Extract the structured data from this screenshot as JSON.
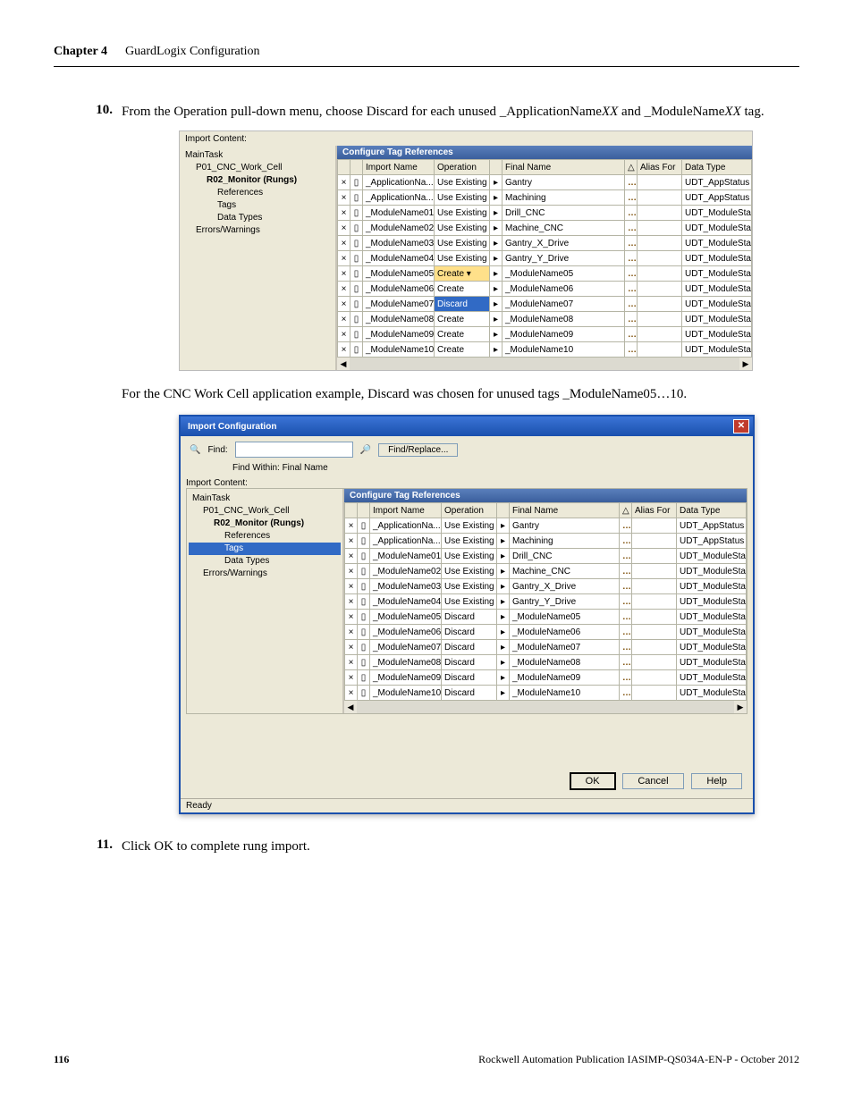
{
  "header": {
    "chapter_label": "Chapter 4",
    "chapter_title": "GuardLogix Configuration"
  },
  "steps": {
    "s10": {
      "num": "10.",
      "text": "From the Operation pull-down menu, choose Discard for each unused _ApplicationNameXX and _ModuleNameXX tag."
    },
    "s11": {
      "num": "11.",
      "text": "Click OK to complete rung import."
    }
  },
  "mid_text": "For the CNC Work Cell application example, Discard was chosen for unused tags _ModuleName05…10.",
  "screenshot1": {
    "import_content_label": "Import Content:",
    "tree": {
      "main": "MainTask",
      "p01": "P01_CNC_Work_Cell",
      "r02": "R02_Monitor (Rungs)",
      "refs": "References",
      "tags": "Tags",
      "datatypes": "Data Types",
      "errors": "Errors/Warnings"
    },
    "grid_title": "Configure Tag References",
    "columns": {
      "import": "Import Name",
      "operation": "Operation",
      "final": "Final Name",
      "alias": "Alias For",
      "datatype": "Data Type"
    },
    "rows": [
      {
        "import": "_ApplicationNa...",
        "op": "Use Existing",
        "final": "Gantry",
        "dt": "UDT_AppStatus"
      },
      {
        "import": "_ApplicationNa...",
        "op": "Use Existing",
        "final": "Machining",
        "dt": "UDT_AppStatus"
      },
      {
        "import": "_ModuleName01",
        "op": "Use Existing",
        "final": "Drill_CNC",
        "dt": "UDT_ModuleSta"
      },
      {
        "import": "_ModuleName02",
        "op": "Use Existing",
        "final": "Machine_CNC",
        "dt": "UDT_ModuleSta"
      },
      {
        "import": "_ModuleName03",
        "op": "Use Existing",
        "final": "Gantry_X_Drive",
        "dt": "UDT_ModuleSta"
      },
      {
        "import": "_ModuleName04",
        "op": "Use Existing",
        "final": "Gantry_Y_Drive",
        "dt": "UDT_ModuleSta"
      },
      {
        "import": "_ModuleName05",
        "op": "Create",
        "final": "_ModuleName05",
        "dt": "UDT_ModuleSta",
        "dropdown": true
      },
      {
        "import": "_ModuleName06",
        "op": "Create",
        "final": "_ModuleName06",
        "dt": "UDT_ModuleSta"
      },
      {
        "import": "_ModuleName07",
        "op": "Discard",
        "final": "_ModuleName07",
        "dt": "UDT_ModuleSta",
        "opsel": true
      },
      {
        "import": "_ModuleName08",
        "op": "Create",
        "final": "_ModuleName08",
        "dt": "UDT_ModuleSta"
      },
      {
        "import": "_ModuleName09",
        "op": "Create",
        "final": "_ModuleName09",
        "dt": "UDT_ModuleSta"
      },
      {
        "import": "_ModuleName10",
        "op": "Create",
        "final": "_ModuleName10",
        "dt": "UDT_ModuleSta"
      }
    ]
  },
  "screenshot2": {
    "title": "Import Configuration",
    "find_label": "Find:",
    "find_replace_btn": "Find/Replace...",
    "find_within": "Find Within: Final Name",
    "import_content_label": "Import Content:",
    "tree": {
      "main": "MainTask",
      "p01": "P01_CNC_Work_Cell",
      "r02": "R02_Monitor (Rungs)",
      "refs": "References",
      "tags": "Tags",
      "datatypes": "Data Types",
      "errors": "Errors/Warnings"
    },
    "grid_title": "Configure Tag References",
    "columns": {
      "import": "Import Name",
      "operation": "Operation",
      "final": "Final Name",
      "alias": "Alias For",
      "datatype": "Data Type"
    },
    "rows": [
      {
        "import": "_ApplicationNa...",
        "op": "Use Existing",
        "final": "Gantry",
        "dt": "UDT_AppStatus"
      },
      {
        "import": "_ApplicationNa...",
        "op": "Use Existing",
        "final": "Machining",
        "dt": "UDT_AppStatus"
      },
      {
        "import": "_ModuleName01",
        "op": "Use Existing",
        "final": "Drill_CNC",
        "dt": "UDT_ModuleSta"
      },
      {
        "import": "_ModuleName02",
        "op": "Use Existing",
        "final": "Machine_CNC",
        "dt": "UDT_ModuleSta"
      },
      {
        "import": "_ModuleName03",
        "op": "Use Existing",
        "final": "Gantry_X_Drive",
        "dt": "UDT_ModuleSta"
      },
      {
        "import": "_ModuleName04",
        "op": "Use Existing",
        "final": "Gantry_Y_Drive",
        "dt": "UDT_ModuleSta"
      },
      {
        "import": "_ModuleName05",
        "op": "Discard",
        "final": "_ModuleName05",
        "dt": "UDT_ModuleSta"
      },
      {
        "import": "_ModuleName06",
        "op": "Discard",
        "final": "_ModuleName06",
        "dt": "UDT_ModuleSta"
      },
      {
        "import": "_ModuleName07",
        "op": "Discard",
        "final": "_ModuleName07",
        "dt": "UDT_ModuleSta"
      },
      {
        "import": "_ModuleName08",
        "op": "Discard",
        "final": "_ModuleName08",
        "dt": "UDT_ModuleSta"
      },
      {
        "import": "_ModuleName09",
        "op": "Discard",
        "final": "_ModuleName09",
        "dt": "UDT_ModuleSta"
      },
      {
        "import": "_ModuleName10",
        "op": "Discard",
        "final": "_ModuleName10",
        "dt": "UDT_ModuleSta"
      }
    ],
    "buttons": {
      "ok": "OK",
      "cancel": "Cancel",
      "help": "Help"
    },
    "status": "Ready"
  },
  "footer": {
    "page": "116",
    "pub": "Rockwell Automation Publication IASIMP-QS034A-EN-P - October 2012"
  }
}
